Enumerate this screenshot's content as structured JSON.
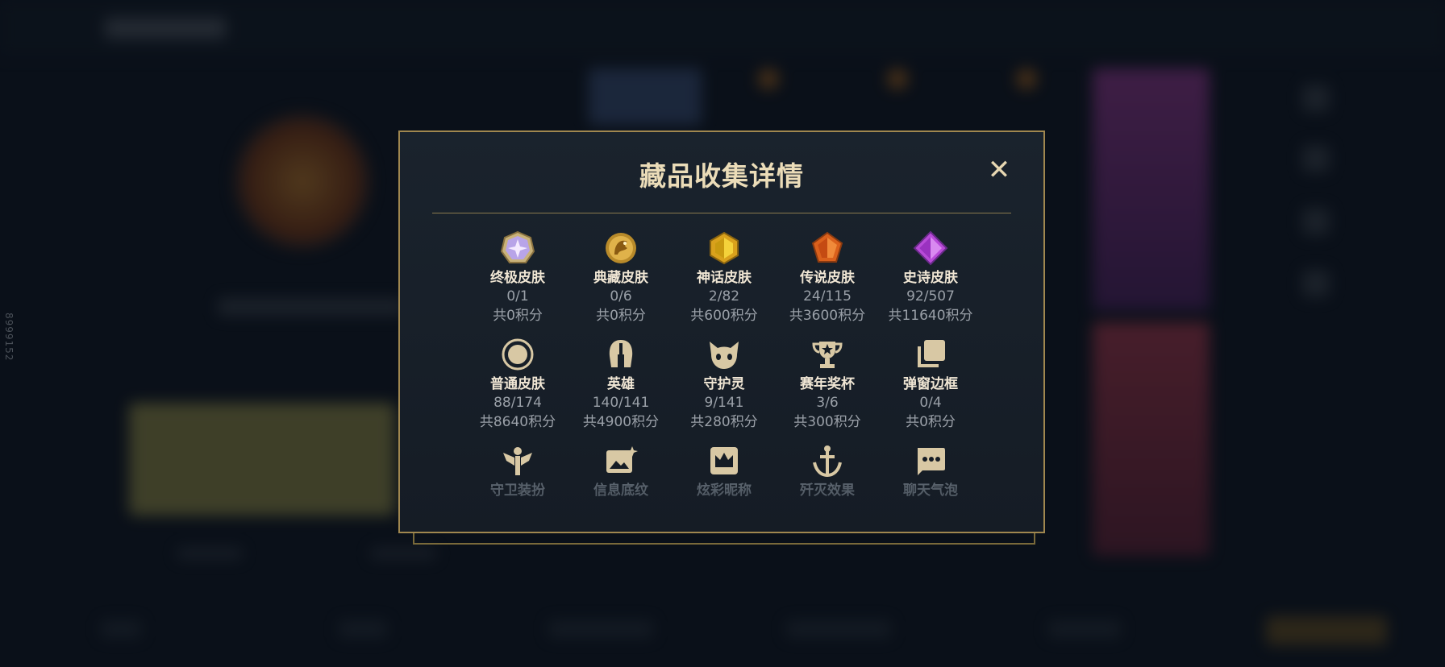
{
  "background": {
    "side_text": "8999152"
  },
  "modal": {
    "title": "藏品收集详情",
    "close_label": "✕",
    "accent": "#a0874f",
    "items": [
      {
        "name": "终极皮肤",
        "count": "0/1",
        "points": "共0积分",
        "icon": "ultimate-skin-icon"
      },
      {
        "name": "典藏皮肤",
        "count": "0/6",
        "points": "共0积分",
        "icon": "prestige-skin-icon"
      },
      {
        "name": "神话皮肤",
        "count": "2/82",
        "points": "共600积分",
        "icon": "mythic-skin-icon"
      },
      {
        "name": "传说皮肤",
        "count": "24/115",
        "points": "共3600积分",
        "icon": "legendary-skin-icon"
      },
      {
        "name": "史诗皮肤",
        "count": "92/507",
        "points": "共11640积分",
        "icon": "epic-skin-icon"
      },
      {
        "name": "普通皮肤",
        "count": "88/174",
        "points": "共8640积分",
        "icon": "common-skin-icon"
      },
      {
        "name": "英雄",
        "count": "140/141",
        "points": "共4900积分",
        "icon": "champion-helmet-icon"
      },
      {
        "name": "守护灵",
        "count": "9/141",
        "points": "共280积分",
        "icon": "guardian-spirit-icon"
      },
      {
        "name": "赛年奖杯",
        "count": "3/6",
        "points": "共300积分",
        "icon": "trophy-icon"
      },
      {
        "name": "弹窗边框",
        "count": "0/4",
        "points": "共0积分",
        "icon": "popup-frame-icon"
      },
      {
        "name": "守卫装扮",
        "icon": "ward-skin-icon"
      },
      {
        "name": "信息底纹",
        "icon": "banner-pattern-icon"
      },
      {
        "name": "炫彩昵称",
        "icon": "crown-nickname-icon"
      },
      {
        "name": "歼灭效果",
        "icon": "annihilate-effect-icon"
      },
      {
        "name": "聊天气泡",
        "icon": "chat-bubble-icon"
      }
    ]
  }
}
